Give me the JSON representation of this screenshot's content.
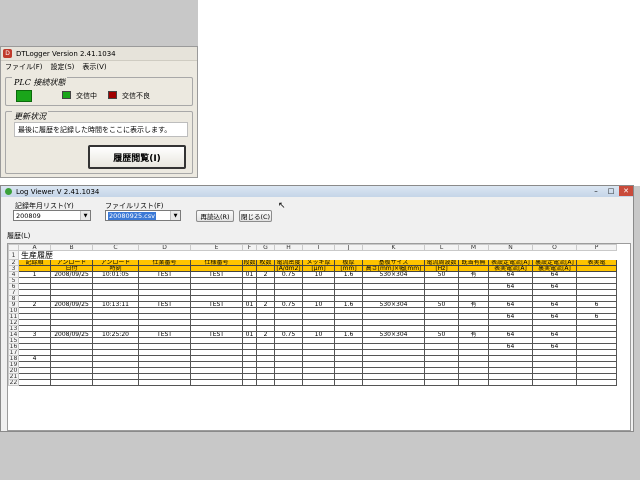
{
  "dtlogger": {
    "title": "DTLogger   Version 2.41.1034",
    "menu": [
      "ファイル(F)",
      "設定(S)",
      "表示(V)"
    ],
    "plc_group_title": "PLC 接続状態",
    "legend": [
      {
        "label": "交信中",
        "color": "#1aa51a"
      },
      {
        "label": "交信不良",
        "color": "#a00000"
      }
    ],
    "status_group_title": "更新状況",
    "status_text": "最後に履歴を記録した時間をここに表示します。",
    "history_button": "履歴閲覧(I)"
  },
  "logviewer": {
    "title": "Log Viewer V 2.41.1034",
    "window_controls": [
      "–",
      "□",
      "✕"
    ],
    "year_month_label": "記録年月リスト(Y)",
    "year_month_value": "200809",
    "file_list_label": "ファイルリスト(F)",
    "file_list_value": "20080925.csv",
    "reload_button": "再読込(R)",
    "close_button": "閉じる(C)",
    "history_label": "履歴(L)",
    "sheet": {
      "col_letters": [
        "A",
        "B",
        "C",
        "D",
        "E",
        "F",
        "G",
        "H",
        "I",
        "J",
        "K",
        "L",
        "M",
        "N",
        "O",
        "P"
      ],
      "title": "生産履歴",
      "header_row2": [
        "記録順",
        "アンロード",
        "アンロード",
        "仕業番号",
        "仕様番号",
        "段数",
        "枚数",
        "電流密度",
        "メッキ厚",
        "板厚",
        "基板サイズ",
        "電流周波数",
        "既当有無",
        "表設定電流[A]",
        "裏設定電流[A]",
        "表実電"
      ],
      "header_row3": [
        "",
        "日付",
        "時刻",
        "",
        "",
        "",
        "",
        "[A/dm2]",
        "[μm]",
        "[mm]",
        "高さ[mm]×幅[mm]",
        "[Hz]",
        "",
        "表実電流[A]",
        "裏実電流[A]",
        ""
      ],
      "records": [
        {
          "row": "4",
          "no": "1",
          "date": "2008/09/25",
          "time": "10:01:05",
          "job": "TEST",
          "spec": "TEST",
          "stage": "01",
          "sheets": "2",
          "density": "0.75",
          "thick": "10",
          "board": "1.6",
          "size": "530×304",
          "freq": "50",
          "flag": "有",
          "front": "64",
          "back": "64",
          "front_actual": "64",
          "back_actual": "64",
          "p1": "",
          "p2": ""
        },
        {
          "row": "9",
          "no": "2",
          "date": "2008/09/25",
          "time": "10:13:11",
          "job": "TEST",
          "spec": "TEST",
          "stage": "01",
          "sheets": "2",
          "density": "0.75",
          "thick": "10",
          "board": "1.6",
          "size": "530×304",
          "freq": "50",
          "flag": "有",
          "front": "64",
          "back": "64",
          "front_actual": "64",
          "back_actual": "64",
          "p1": "6",
          "p2": "6"
        },
        {
          "row": "14",
          "no": "3",
          "date": "2008/09/25",
          "time": "10:25:20",
          "job": "TEST",
          "spec": "TEST",
          "stage": "01",
          "sheets": "2",
          "density": "0.75",
          "thick": "10",
          "board": "1.6",
          "size": "530×304",
          "freq": "50",
          "flag": "有",
          "front": "64",
          "back": "64",
          "front_actual": "64",
          "back_actual": "64",
          "p1": "",
          "p2": ""
        }
      ],
      "row18_no": "4",
      "row_numbers": [
        "1",
        "2",
        "3",
        "4",
        "5",
        "6",
        "7",
        "8",
        "9",
        "10",
        "11",
        "12",
        "13",
        "14",
        "15",
        "16",
        "17",
        "18",
        "19",
        "20",
        "21",
        "22"
      ]
    }
  }
}
